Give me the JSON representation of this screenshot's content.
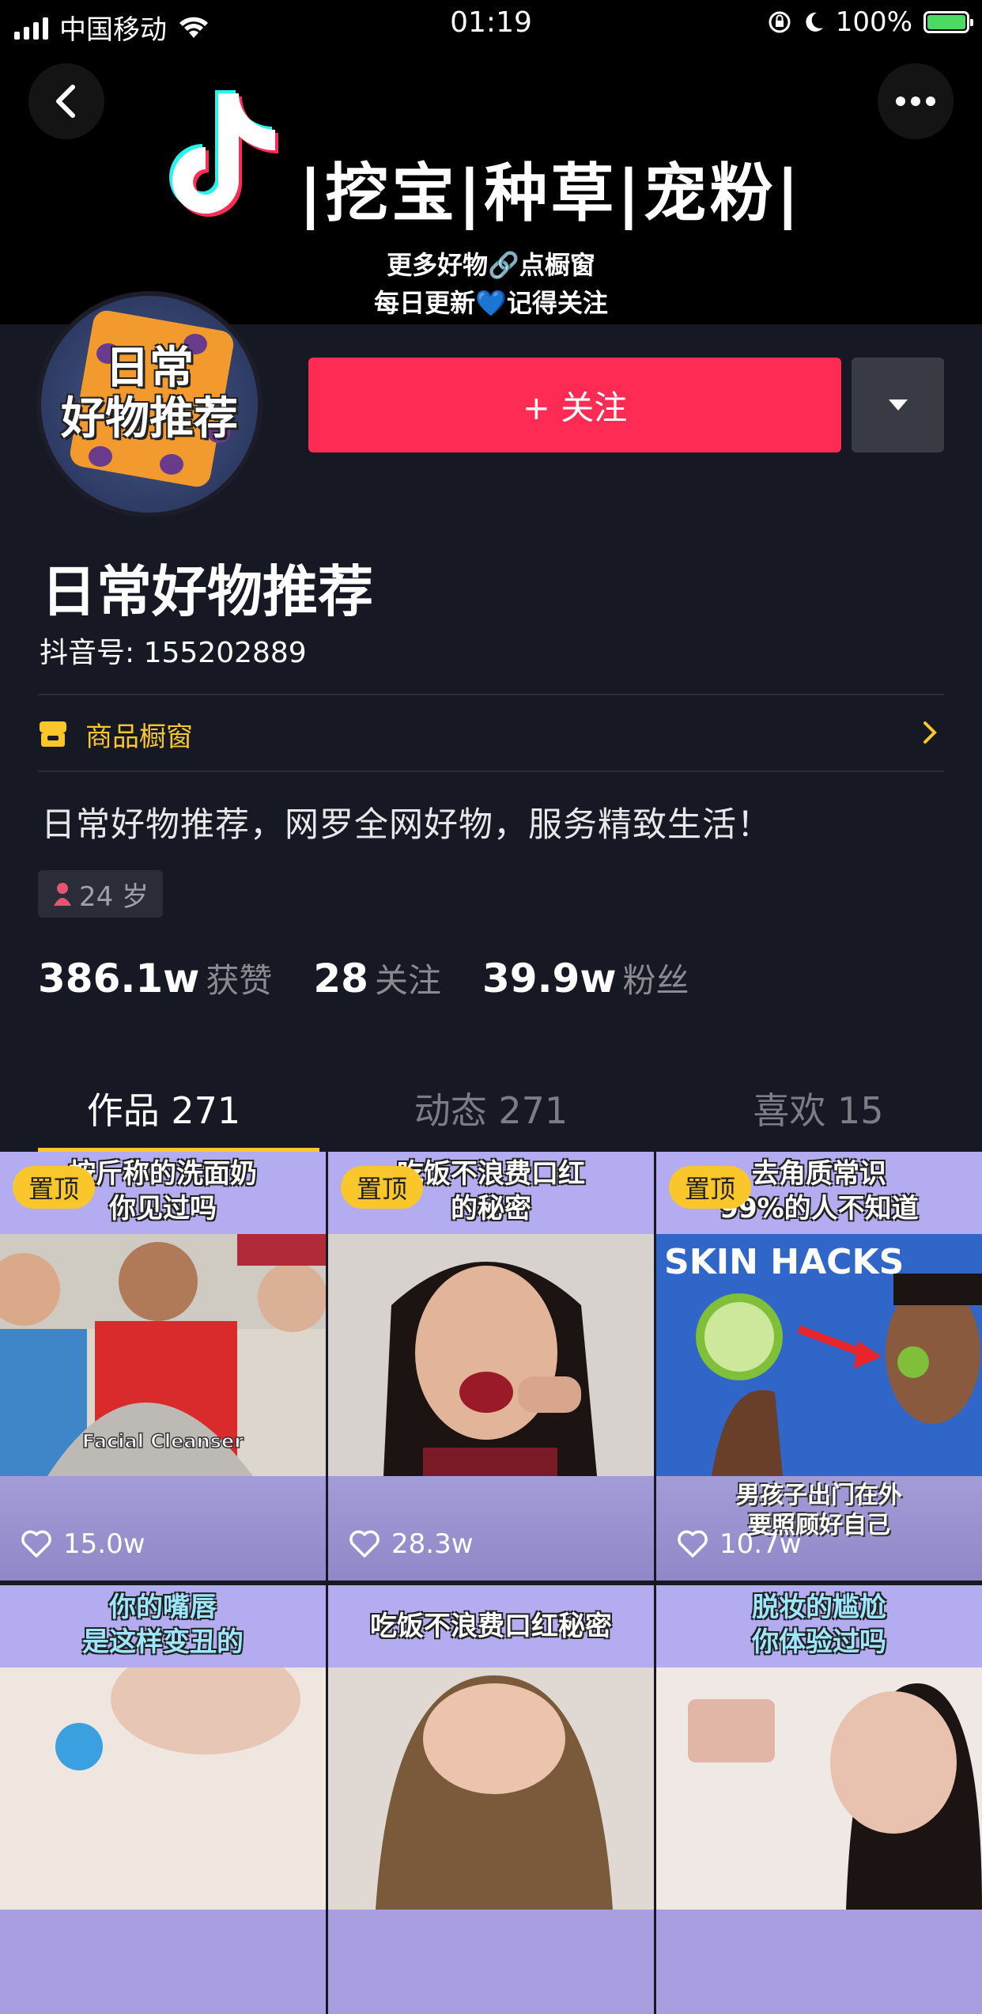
{
  "status_bar": {
    "carrier": "中国移动",
    "time": "01:19",
    "battery": "100%"
  },
  "banner": {
    "slogan": "|挖宝|种草|宠粉|",
    "line1": "更多好物🔗点橱窗",
    "line2": "每日更新💙记得关注"
  },
  "avatar": {
    "line1": "日常",
    "line2": "好物推荐"
  },
  "follow": {
    "label": "+ 关注"
  },
  "profile": {
    "nickname": "日常好物推荐",
    "douyin_id": "抖音号: 155202889",
    "shop_label": "商品橱窗",
    "bio": "日常好物推荐，网罗全网好物，服务精致生活！",
    "age": "24 岁"
  },
  "stats": [
    {
      "num": "386.1w",
      "label": "获赞"
    },
    {
      "num": "28",
      "label": "关注"
    },
    {
      "num": "39.9w",
      "label": "粉丝"
    }
  ],
  "tabs": [
    {
      "label": "作品 271",
      "active": true
    },
    {
      "label": "动态 271",
      "active": false
    },
    {
      "label": "喜欢 15",
      "active": false
    }
  ],
  "videos": [
    {
      "caption": "按斤称的洗面奶\n你见过吗",
      "pinned": "置顶",
      "likes": "15.0w",
      "overlay": "Facial Cleanser"
    },
    {
      "caption": "吃饭不浪费口红\n的秘密",
      "pinned": "置顶",
      "likes": "28.3w",
      "overlay": ""
    },
    {
      "caption": "去角质常识\n99%的人不知道",
      "pinned": "置顶",
      "likes": "10.7w",
      "overlay": "男孩子出门在外\n要照顾好自己",
      "photo_text": "SKIN HACKS"
    },
    {
      "caption": "你的嘴唇\n是这样变丑的",
      "pinned": "",
      "likes": "",
      "overlay": ""
    },
    {
      "caption": "吃饭不浪费口红秘密",
      "pinned": "",
      "likes": "",
      "overlay": ""
    },
    {
      "caption": "脱妆的尴尬\n你体验过吗",
      "pinned": "",
      "likes": "",
      "overlay": ""
    }
  ],
  "colors": {
    "background": "#161823",
    "follow": "#fe2c55",
    "accent": "#f9c62c"
  },
  "icons": [
    "signal-icon",
    "wifi-icon",
    "rotation-lock-icon",
    "moon-icon",
    "battery-icon",
    "back-icon",
    "more-icon",
    "tiktok-logo-icon",
    "dropdown-icon",
    "shop-icon",
    "chevron-right-icon",
    "female-icon",
    "heart-icon"
  ]
}
